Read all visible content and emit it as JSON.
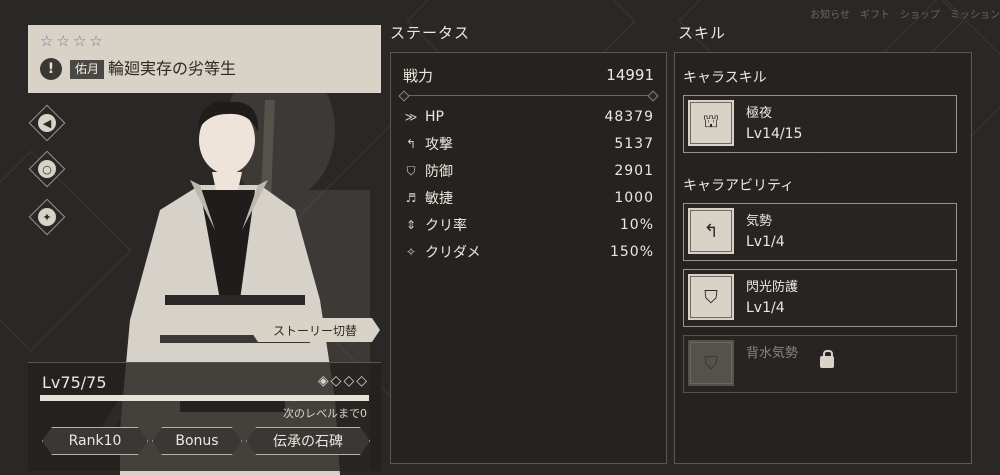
{
  "top_menu": [
    "お知らせ",
    "ギフト",
    "ショップ",
    "ミッション"
  ],
  "character": {
    "stars": [
      "☆",
      "☆",
      "☆",
      "☆"
    ],
    "badge": "佑月",
    "title": "輪廻実存の劣等生",
    "story_button": "ストーリー切替"
  },
  "level_panel": {
    "level": "Lv75/75",
    "xp_progress": 1.0,
    "next_level_text": "次のレベルまで0",
    "buttons": [
      "Rank10",
      "Bonus",
      "伝承の石碑"
    ]
  },
  "status": {
    "heading": "ステータス",
    "power_label": "戦力",
    "power_value": "14991",
    "rows": [
      {
        "icon": "hp-icon",
        "label": "HP",
        "value": "48379"
      },
      {
        "icon": "attack-icon",
        "label": "攻撃",
        "value": "5137"
      },
      {
        "icon": "defense-icon",
        "label": "防御",
        "value": "2901"
      },
      {
        "icon": "agility-icon",
        "label": "敏捷",
        "value": "1000"
      },
      {
        "icon": "crit-rate-icon",
        "label": "クリ率",
        "value": "10%"
      },
      {
        "icon": "crit-damage-icon",
        "label": "クリダメ",
        "value": "150%"
      }
    ]
  },
  "skills": {
    "heading": "スキル",
    "chara_skill_label": "キャラスキル",
    "chara_ability_label": "キャラアビリティ",
    "chara_skill": {
      "name": "極夜",
      "level": "Lv14/15"
    },
    "abilities": [
      {
        "name": "気勢",
        "level": "Lv1/4",
        "locked": false
      },
      {
        "name": "閃光防護",
        "level": "Lv1/4",
        "locked": false
      },
      {
        "name": "背水気勢",
        "level": "",
        "locked": true
      }
    ]
  }
}
